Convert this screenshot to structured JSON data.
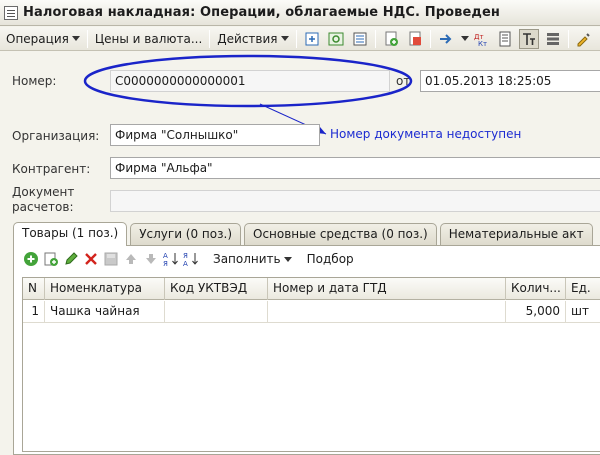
{
  "window": {
    "title": "Налоговая накладная: Операции, облагаемые НДС. Проведен"
  },
  "toolbar": {
    "operation_label": "Операция",
    "prices_label": "Цены и валюта...",
    "actions_label": "Действия"
  },
  "form": {
    "number_label": "Номер:",
    "number_value": "С0000000000000001",
    "date_sep_label": "от",
    "date_value": "01.05.2013 18:25:05",
    "org_label": "Организация:",
    "org_value": "Фирма \"Солнышко\"",
    "contractor_label": "Контрагент:",
    "contractor_value": "Фирма \"Альфа\"",
    "settlement_doc_label_line1": "Документ",
    "settlement_doc_label_line2": "расчетов:",
    "settlement_doc_value": ""
  },
  "annotation": {
    "text": "Номер документа недоступен",
    "color": "#1c2bd1"
  },
  "tabs": [
    {
      "label": "Товары (1 поз.)",
      "active": true
    },
    {
      "label": "Услуги (0 поз.)",
      "active": false
    },
    {
      "label": "Основные средства (0 поз.)",
      "active": false
    },
    {
      "label": "Нематериальные акт",
      "active": false
    }
  ],
  "subtoolbar": {
    "fill_label": "Заполнить",
    "select_label": "Подбор"
  },
  "table": {
    "columns": [
      "N",
      "Номенклатура",
      "Код УКТВЭД",
      "Номер и дата ГТД",
      "Колич...",
      "Ед."
    ],
    "rows": [
      {
        "n": "1",
        "item": "Чашка чайная",
        "code": "",
        "gtd": "",
        "qty": "5,000",
        "unit": "шт"
      }
    ]
  }
}
